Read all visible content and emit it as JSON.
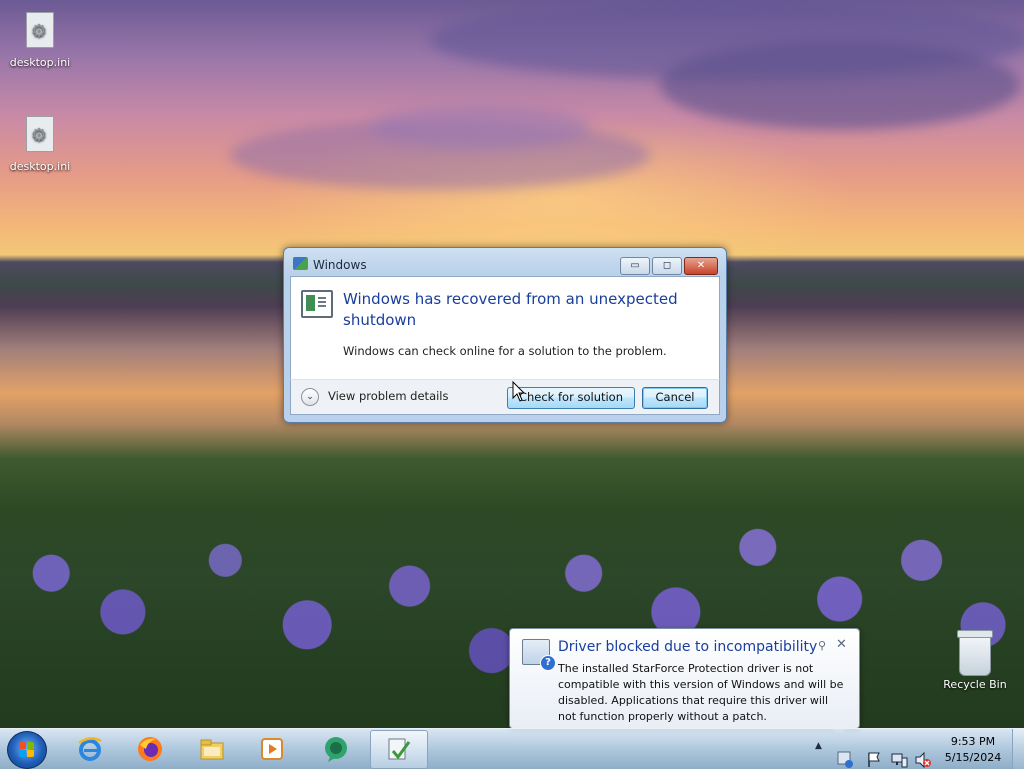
{
  "desktop": {
    "icons": [
      {
        "label": "desktop.ini"
      },
      {
        "label": "desktop.ini"
      },
      {
        "label": "Recycle Bin"
      }
    ]
  },
  "dialog": {
    "window_title": "Windows",
    "heading": "Windows has recovered from an unexpected shutdown",
    "message": "Windows can check online for a solution to the problem.",
    "details_label": "View problem details",
    "check_button": "Check for solution",
    "cancel_button": "Cancel",
    "minimize_glyph": "▭",
    "maximize_glyph": "◻",
    "close_glyph": "✕"
  },
  "notification": {
    "title": "Driver blocked due to incompatibility",
    "body": "The installed StarForce Protection driver is not compatible with this version of Windows and will be disabled.  Applications that require this driver will not function properly without a patch.",
    "close_glyph": "✕",
    "pin_glyph": "⚲"
  },
  "taskbar": {
    "pinned": [
      {
        "name": "internet-explorer-icon"
      },
      {
        "name": "firefox-icon"
      },
      {
        "name": "file-explorer-icon"
      },
      {
        "name": "media-player-icon"
      },
      {
        "name": "chat-app-icon"
      },
      {
        "name": "windows-problem-report-icon"
      }
    ],
    "tray_expand_glyph": "▲",
    "time": "9:53 PM",
    "date": "5/15/2024"
  },
  "colors": {
    "heading_blue": "#1a3e9c",
    "close_red": "#c7442b",
    "taskbar": "#a5bfd8"
  }
}
